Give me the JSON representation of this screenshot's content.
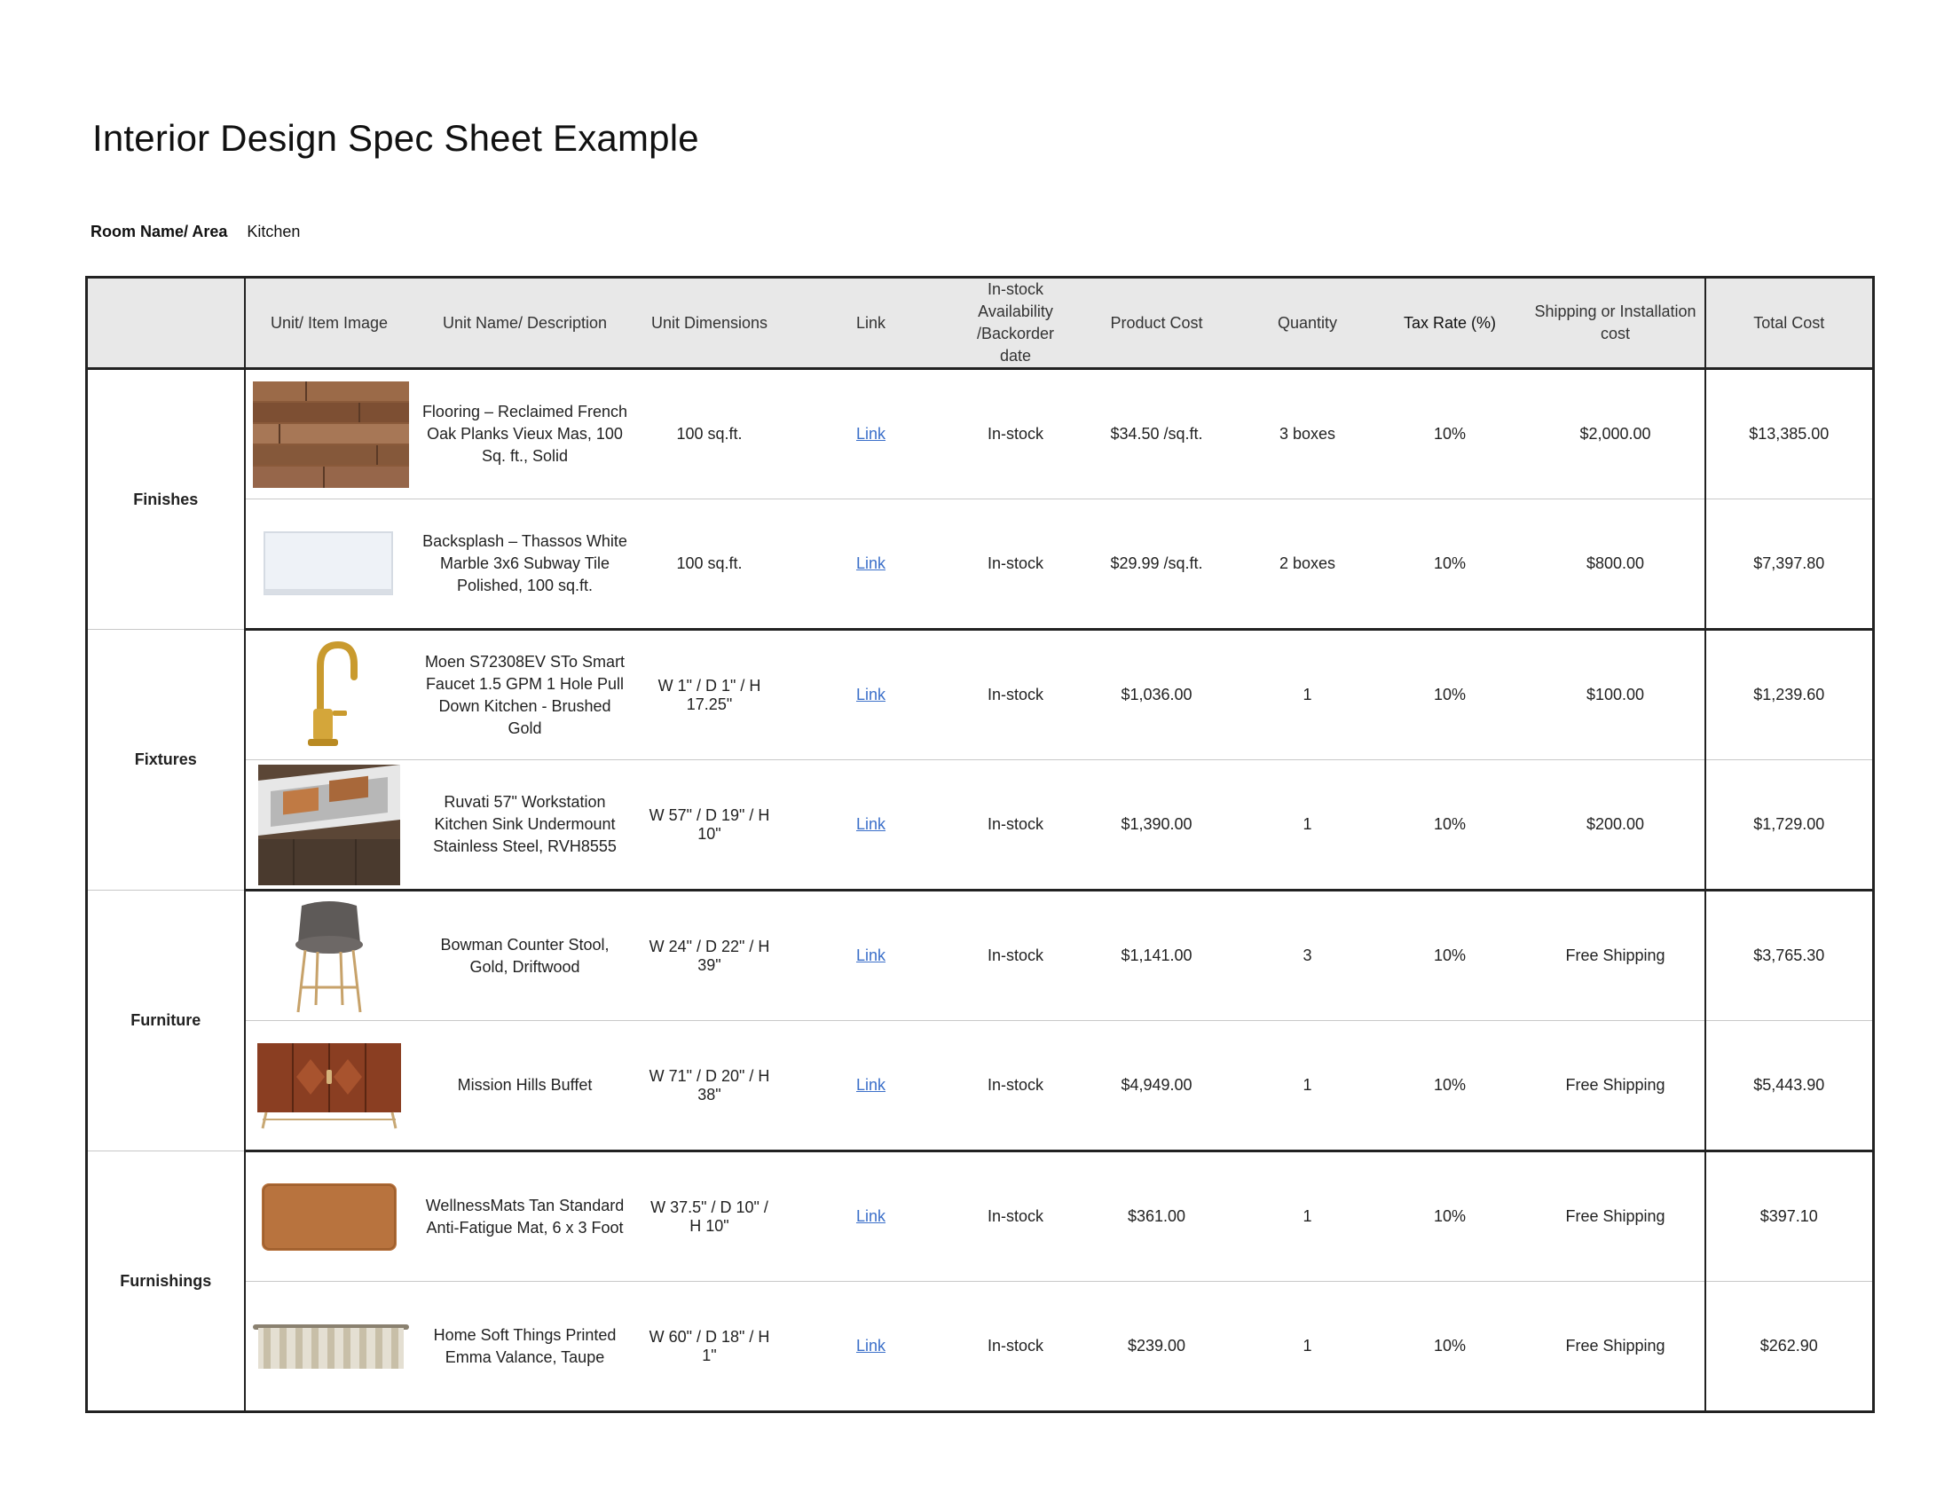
{
  "title": "Interior Design Spec Sheet Example",
  "room": {
    "label": "Room Name/ Area",
    "value": "Kitchen"
  },
  "headers": {
    "image": "Unit/ Item Image",
    "name": "Unit Name/ Description",
    "dims": "Unit Dimensions",
    "link": "Link",
    "avail": "In-stock Availability /Backorder date",
    "cost": "Product Cost",
    "qty": "Quantity",
    "tax": "Tax Rate (%)",
    "ship": "Shipping or Installation cost",
    "total": "Total Cost"
  },
  "categories": [
    "Finishes",
    "Fixtures",
    "Furniture",
    "Furnishings"
  ],
  "rows": [
    {
      "image_icon": "wood-flooring-image",
      "name": "Flooring – Reclaimed French Oak Planks Vieux Mas, 100 Sq. ft., Solid",
      "dims": "100 sq.ft.",
      "link": "Link",
      "avail": "In-stock",
      "cost": "$34.50 /sq.ft.",
      "qty": "3 boxes",
      "tax": "10%",
      "ship": "$2,000.00",
      "total": "$13,385.00"
    },
    {
      "image_icon": "marble-tile-image",
      "name": "Backsplash – Thassos White Marble 3x6 Subway Tile Polished, 100 sq.ft.",
      "dims": "100 sq.ft.",
      "link": "Link",
      "avail": "In-stock",
      "cost": "$29.99 /sq.ft.",
      "qty": "2 boxes",
      "tax": "10%",
      "ship": "$800.00",
      "total": "$7,397.80"
    },
    {
      "image_icon": "gold-faucet-image",
      "name": "Moen S72308EV STo Smart Faucet 1.5 GPM 1 Hole Pull Down Kitchen - Brushed Gold",
      "dims": "W 1\" / D 1\" / H 17.25\"",
      "link": "Link",
      "avail": "In-stock",
      "cost": "$1,036.00",
      "qty": "1",
      "tax": "10%",
      "ship": "$100.00",
      "total": "$1,239.60"
    },
    {
      "image_icon": "kitchen-sink-image",
      "name": "Ruvati 57\" Workstation Kitchen Sink Undermount Stainless Steel, RVH8555",
      "dims": "W 57\" / D 19\" / H 10\"",
      "link": "Link",
      "avail": "In-stock",
      "cost": "$1,390.00",
      "qty": "1",
      "tax": "10%",
      "ship": "$200.00",
      "total": "$1,729.00"
    },
    {
      "image_icon": "counter-stool-image",
      "name": "Bowman Counter Stool, Gold, Driftwood",
      "dims": "W 24\" / D 22\" / H 39\"",
      "link": "Link",
      "avail": "In-stock",
      "cost": "$1,141.00",
      "qty": "3",
      "tax": "10%",
      "ship": "Free Shipping",
      "total": "$3,765.30"
    },
    {
      "image_icon": "buffet-cabinet-image",
      "name": "Mission Hills Buffet",
      "dims": "W 71\" / D 20\" / H 38\"",
      "link": "Link",
      "avail": "In-stock",
      "cost": "$4,949.00",
      "qty": "1",
      "tax": "10%",
      "ship": "Free Shipping",
      "total": "$5,443.90"
    },
    {
      "image_icon": "floor-mat-image",
      "name": "WellnessMats Tan Standard Anti-Fatigue Mat, 6 x 3 Foot",
      "dims": "W 37.5\" / D 10\" / H 10\"",
      "link": "Link",
      "avail": "In-stock",
      "cost": "$361.00",
      "qty": "1",
      "tax": "10%",
      "ship": "Free Shipping",
      "total": "$397.10"
    },
    {
      "image_icon": "valance-curtain-image",
      "name": "Home Soft Things Printed Emma Valance, Taupe",
      "dims": "W 60\" / D 18\" / H 1\"",
      "link": "Link",
      "avail": "In-stock",
      "cost": "$239.00",
      "qty": "1",
      "tax": "10%",
      "ship": "Free Shipping",
      "total": "$262.90"
    }
  ]
}
